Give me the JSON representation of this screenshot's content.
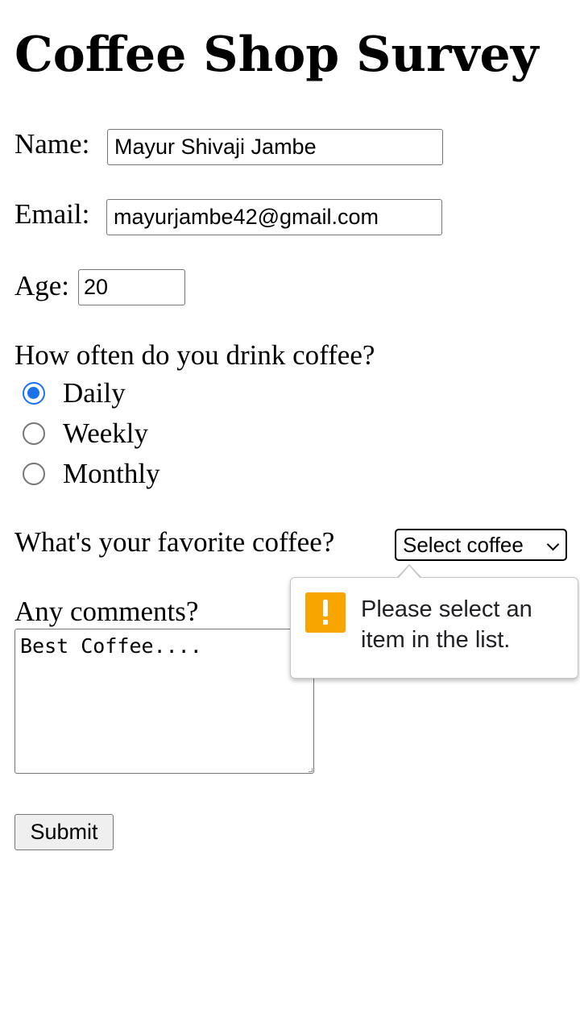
{
  "page": {
    "title": "Coffee Shop Survey"
  },
  "form": {
    "name_label": "Name:",
    "name_value": "Mayur Shivaji Jambe",
    "email_label": "Email:",
    "email_value": "mayurjambe42@gmail.com",
    "age_label": "Age:",
    "age_value": "20",
    "frequency_question": "How often do you drink coffee?",
    "frequency_options": [
      {
        "label": "Daily",
        "checked": true
      },
      {
        "label": "Weekly",
        "checked": false
      },
      {
        "label": "Monthly",
        "checked": false
      }
    ],
    "favorite_question": "What's your favorite coffee?",
    "favorite_selected": "Select coffee",
    "comments_label": "Any comments?",
    "comments_value": "Best Coffee....",
    "submit_label": "Submit"
  },
  "validation_tooltip": {
    "message": "Please select an item in the list.",
    "icon": "warning-icon",
    "icon_color": "#f9a500"
  },
  "colors": {
    "radio_accent": "#1a73e8"
  }
}
